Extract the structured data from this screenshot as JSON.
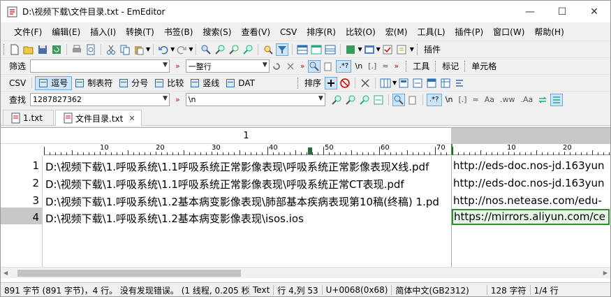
{
  "window": {
    "title": "D:\\视频下载\\文件目录.txt - EmEditor"
  },
  "menu": [
    "文件(F)",
    "编辑(E)",
    "插入(I)",
    "转换(T)",
    "书签(B)",
    "搜索(S)",
    "查看(V)",
    "CSV",
    "排序(R)",
    "比较(O)",
    "宏(M)",
    "工具(L)",
    "插件(P)",
    "窗口(W)",
    "帮助(H)"
  ],
  "toolbar1": {
    "plugins_label": "插件"
  },
  "filterbar": {
    "label": "筛选",
    "filter_value": "",
    "mode_value": "一整行",
    "tools_label": "工具",
    "marks_label": "标记",
    "cells_label": "单元格"
  },
  "csvbar": {
    "csv_label": "CSV",
    "buttons": [
      "逗号",
      "制表符",
      "分号",
      "比较",
      "竖线",
      "DAT"
    ],
    "sort_label": "排序"
  },
  "findbar": {
    "label": "查找",
    "find_value": "1287827362",
    "replace_value": "\\n"
  },
  "tabs": [
    {
      "label": "1.txt"
    },
    {
      "label": "文件目录.txt"
    }
  ],
  "editor": {
    "column1_header": "1",
    "ruler1_ticks": [
      "10",
      "20",
      "30",
      "40",
      "50",
      "60",
      "70"
    ],
    "ruler2_ticks": [
      "10",
      "20"
    ],
    "lines": [
      {
        "num": "1",
        "col1": "D:\\视频下载\\1.呼吸系统\\1.1呼吸系统正常影像表现\\呼吸系统正常影像表现X线.pdf",
        "col2": "http://eds-doc.nos-jd.163yun"
      },
      {
        "num": "2",
        "col1": "D:\\视频下载\\1.呼吸系统\\1.1呼吸系统正常影像表现\\呼吸系统正常CT表现.pdf",
        "col2": "http://eds-doc.nos-jd.163yun"
      },
      {
        "num": "3",
        "col1": "D:\\视频下载\\1.呼吸系统\\1.2基本病变影像表现\\肺部基本疾病表现第10稿(终稿) 1.pd",
        "col2": "http://nos.netease.com/edu-"
      },
      {
        "num": "4",
        "col1": "D:\\视频下载\\1.呼吸系统\\1.2基本病变影像表现\\isos.ios",
        "col2": "https://mirrors.aliyun.com/ce"
      }
    ]
  },
  "statusbar": {
    "summary": "891 字节 (891 字节)，4 行。 没有发现错误。 (1 线程, 0.205 秒) 4",
    "mode": "Text",
    "position": "行 4,列 53",
    "char": "U+0068(0x68)",
    "encoding": "简体中文(GB2312)",
    "chars": "128 字符",
    "cells": "1/4 行"
  },
  "colors": {
    "accent": "#2e6fb5",
    "selected_cell_border": "#2d8f2d",
    "selected_tab": "#ffffff"
  }
}
